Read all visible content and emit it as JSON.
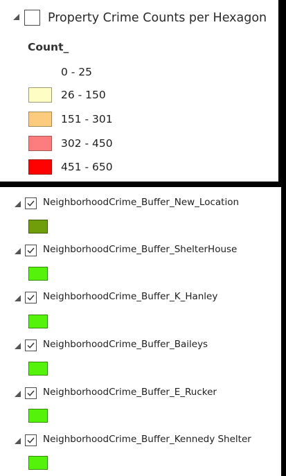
{
  "property_layer": {
    "name": "Property Crime Counts per Hexagon",
    "checked": false,
    "field": "Count_",
    "classes": [
      {
        "label": "0 - 25",
        "color": null
      },
      {
        "label": "26 - 150",
        "color": "#fefdc4"
      },
      {
        "label": "151 - 301",
        "color": "#fdcb7d"
      },
      {
        "label": "302 - 450",
        "color": "#fd7d7e"
      },
      {
        "label": "451 - 650",
        "color": "#fe0202"
      }
    ]
  },
  "buffer_layers": [
    {
      "name": "NeighborhoodCrime_Buffer_New_Location",
      "checked": true,
      "color": "#6f9e09"
    },
    {
      "name": "NeighborhoodCrime_Buffer_ShelterHouse",
      "checked": true,
      "color": "#55f30c"
    },
    {
      "name": "NeighborhoodCrime_Buffer_K_Hanley",
      "checked": true,
      "color": "#55f30c"
    },
    {
      "name": "NeighborhoodCrime_Buffer_Baileys",
      "checked": true,
      "color": "#55f30c"
    },
    {
      "name": "NeighborhoodCrime_Buffer_E_Rucker",
      "checked": true,
      "color": "#55f30c"
    },
    {
      "name": "NeighborhoodCrime_Buffer_Kennedy Shelter",
      "checked": true,
      "color": "#55f30c"
    }
  ]
}
